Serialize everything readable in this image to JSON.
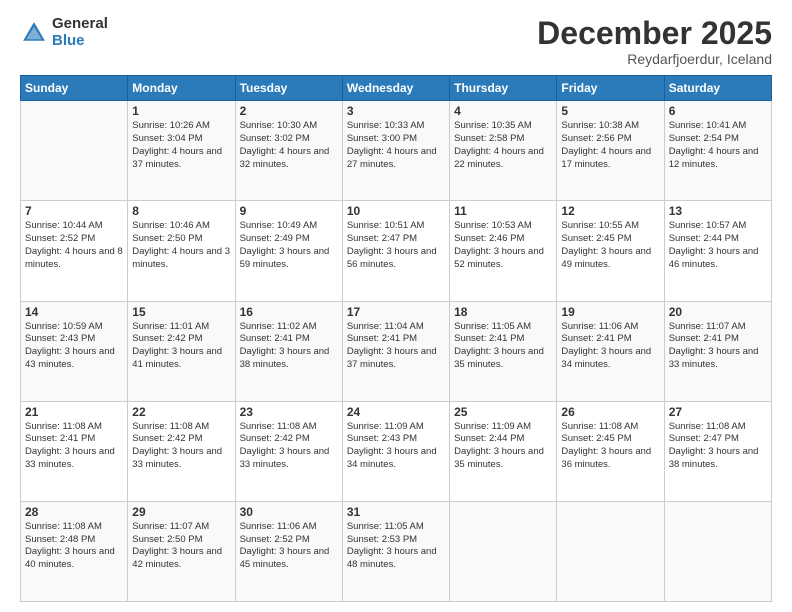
{
  "logo": {
    "text_general": "General",
    "text_blue": "Blue"
  },
  "title": "December 2025",
  "location": "Reydarfjoerdur, Iceland",
  "days_header": [
    "Sunday",
    "Monday",
    "Tuesday",
    "Wednesday",
    "Thursday",
    "Friday",
    "Saturday"
  ],
  "weeks": [
    [
      {
        "day": "",
        "sunrise": "",
        "sunset": "",
        "daylight": ""
      },
      {
        "day": "1",
        "sunrise": "Sunrise: 10:26 AM",
        "sunset": "Sunset: 3:04 PM",
        "daylight": "Daylight: 4 hours and 37 minutes."
      },
      {
        "day": "2",
        "sunrise": "Sunrise: 10:30 AM",
        "sunset": "Sunset: 3:02 PM",
        "daylight": "Daylight: 4 hours and 32 minutes."
      },
      {
        "day": "3",
        "sunrise": "Sunrise: 10:33 AM",
        "sunset": "Sunset: 3:00 PM",
        "daylight": "Daylight: 4 hours and 27 minutes."
      },
      {
        "day": "4",
        "sunrise": "Sunrise: 10:35 AM",
        "sunset": "Sunset: 2:58 PM",
        "daylight": "Daylight: 4 hours and 22 minutes."
      },
      {
        "day": "5",
        "sunrise": "Sunrise: 10:38 AM",
        "sunset": "Sunset: 2:56 PM",
        "daylight": "Daylight: 4 hours and 17 minutes."
      },
      {
        "day": "6",
        "sunrise": "Sunrise: 10:41 AM",
        "sunset": "Sunset: 2:54 PM",
        "daylight": "Daylight: 4 hours and 12 minutes."
      }
    ],
    [
      {
        "day": "7",
        "sunrise": "Sunrise: 10:44 AM",
        "sunset": "Sunset: 2:52 PM",
        "daylight": "Daylight: 4 hours and 8 minutes."
      },
      {
        "day": "8",
        "sunrise": "Sunrise: 10:46 AM",
        "sunset": "Sunset: 2:50 PM",
        "daylight": "Daylight: 4 hours and 3 minutes."
      },
      {
        "day": "9",
        "sunrise": "Sunrise: 10:49 AM",
        "sunset": "Sunset: 2:49 PM",
        "daylight": "Daylight: 3 hours and 59 minutes."
      },
      {
        "day": "10",
        "sunrise": "Sunrise: 10:51 AM",
        "sunset": "Sunset: 2:47 PM",
        "daylight": "Daylight: 3 hours and 56 minutes."
      },
      {
        "day": "11",
        "sunrise": "Sunrise: 10:53 AM",
        "sunset": "Sunset: 2:46 PM",
        "daylight": "Daylight: 3 hours and 52 minutes."
      },
      {
        "day": "12",
        "sunrise": "Sunrise: 10:55 AM",
        "sunset": "Sunset: 2:45 PM",
        "daylight": "Daylight: 3 hours and 49 minutes."
      },
      {
        "day": "13",
        "sunrise": "Sunrise: 10:57 AM",
        "sunset": "Sunset: 2:44 PM",
        "daylight": "Daylight: 3 hours and 46 minutes."
      }
    ],
    [
      {
        "day": "14",
        "sunrise": "Sunrise: 10:59 AM",
        "sunset": "Sunset: 2:43 PM",
        "daylight": "Daylight: 3 hours and 43 minutes."
      },
      {
        "day": "15",
        "sunrise": "Sunrise: 11:01 AM",
        "sunset": "Sunset: 2:42 PM",
        "daylight": "Daylight: 3 hours and 41 minutes."
      },
      {
        "day": "16",
        "sunrise": "Sunrise: 11:02 AM",
        "sunset": "Sunset: 2:41 PM",
        "daylight": "Daylight: 3 hours and 38 minutes."
      },
      {
        "day": "17",
        "sunrise": "Sunrise: 11:04 AM",
        "sunset": "Sunset: 2:41 PM",
        "daylight": "Daylight: 3 hours and 37 minutes."
      },
      {
        "day": "18",
        "sunrise": "Sunrise: 11:05 AM",
        "sunset": "Sunset: 2:41 PM",
        "daylight": "Daylight: 3 hours and 35 minutes."
      },
      {
        "day": "19",
        "sunrise": "Sunrise: 11:06 AM",
        "sunset": "Sunset: 2:41 PM",
        "daylight": "Daylight: 3 hours and 34 minutes."
      },
      {
        "day": "20",
        "sunrise": "Sunrise: 11:07 AM",
        "sunset": "Sunset: 2:41 PM",
        "daylight": "Daylight: 3 hours and 33 minutes."
      }
    ],
    [
      {
        "day": "21",
        "sunrise": "Sunrise: 11:08 AM",
        "sunset": "Sunset: 2:41 PM",
        "daylight": "Daylight: 3 hours and 33 minutes."
      },
      {
        "day": "22",
        "sunrise": "Sunrise: 11:08 AM",
        "sunset": "Sunset: 2:42 PM",
        "daylight": "Daylight: 3 hours and 33 minutes."
      },
      {
        "day": "23",
        "sunrise": "Sunrise: 11:08 AM",
        "sunset": "Sunset: 2:42 PM",
        "daylight": "Daylight: 3 hours and 33 minutes."
      },
      {
        "day": "24",
        "sunrise": "Sunrise: 11:09 AM",
        "sunset": "Sunset: 2:43 PM",
        "daylight": "Daylight: 3 hours and 34 minutes."
      },
      {
        "day": "25",
        "sunrise": "Sunrise: 11:09 AM",
        "sunset": "Sunset: 2:44 PM",
        "daylight": "Daylight: 3 hours and 35 minutes."
      },
      {
        "day": "26",
        "sunrise": "Sunrise: 11:08 AM",
        "sunset": "Sunset: 2:45 PM",
        "daylight": "Daylight: 3 hours and 36 minutes."
      },
      {
        "day": "27",
        "sunrise": "Sunrise: 11:08 AM",
        "sunset": "Sunset: 2:47 PM",
        "daylight": "Daylight: 3 hours and 38 minutes."
      }
    ],
    [
      {
        "day": "28",
        "sunrise": "Sunrise: 11:08 AM",
        "sunset": "Sunset: 2:48 PM",
        "daylight": "Daylight: 3 hours and 40 minutes."
      },
      {
        "day": "29",
        "sunrise": "Sunrise: 11:07 AM",
        "sunset": "Sunset: 2:50 PM",
        "daylight": "Daylight: 3 hours and 42 minutes."
      },
      {
        "day": "30",
        "sunrise": "Sunrise: 11:06 AM",
        "sunset": "Sunset: 2:52 PM",
        "daylight": "Daylight: 3 hours and 45 minutes."
      },
      {
        "day": "31",
        "sunrise": "Sunrise: 11:05 AM",
        "sunset": "Sunset: 2:53 PM",
        "daylight": "Daylight: 3 hours and 48 minutes."
      },
      {
        "day": "",
        "sunrise": "",
        "sunset": "",
        "daylight": ""
      },
      {
        "day": "",
        "sunrise": "",
        "sunset": "",
        "daylight": ""
      },
      {
        "day": "",
        "sunrise": "",
        "sunset": "",
        "daylight": ""
      }
    ]
  ]
}
